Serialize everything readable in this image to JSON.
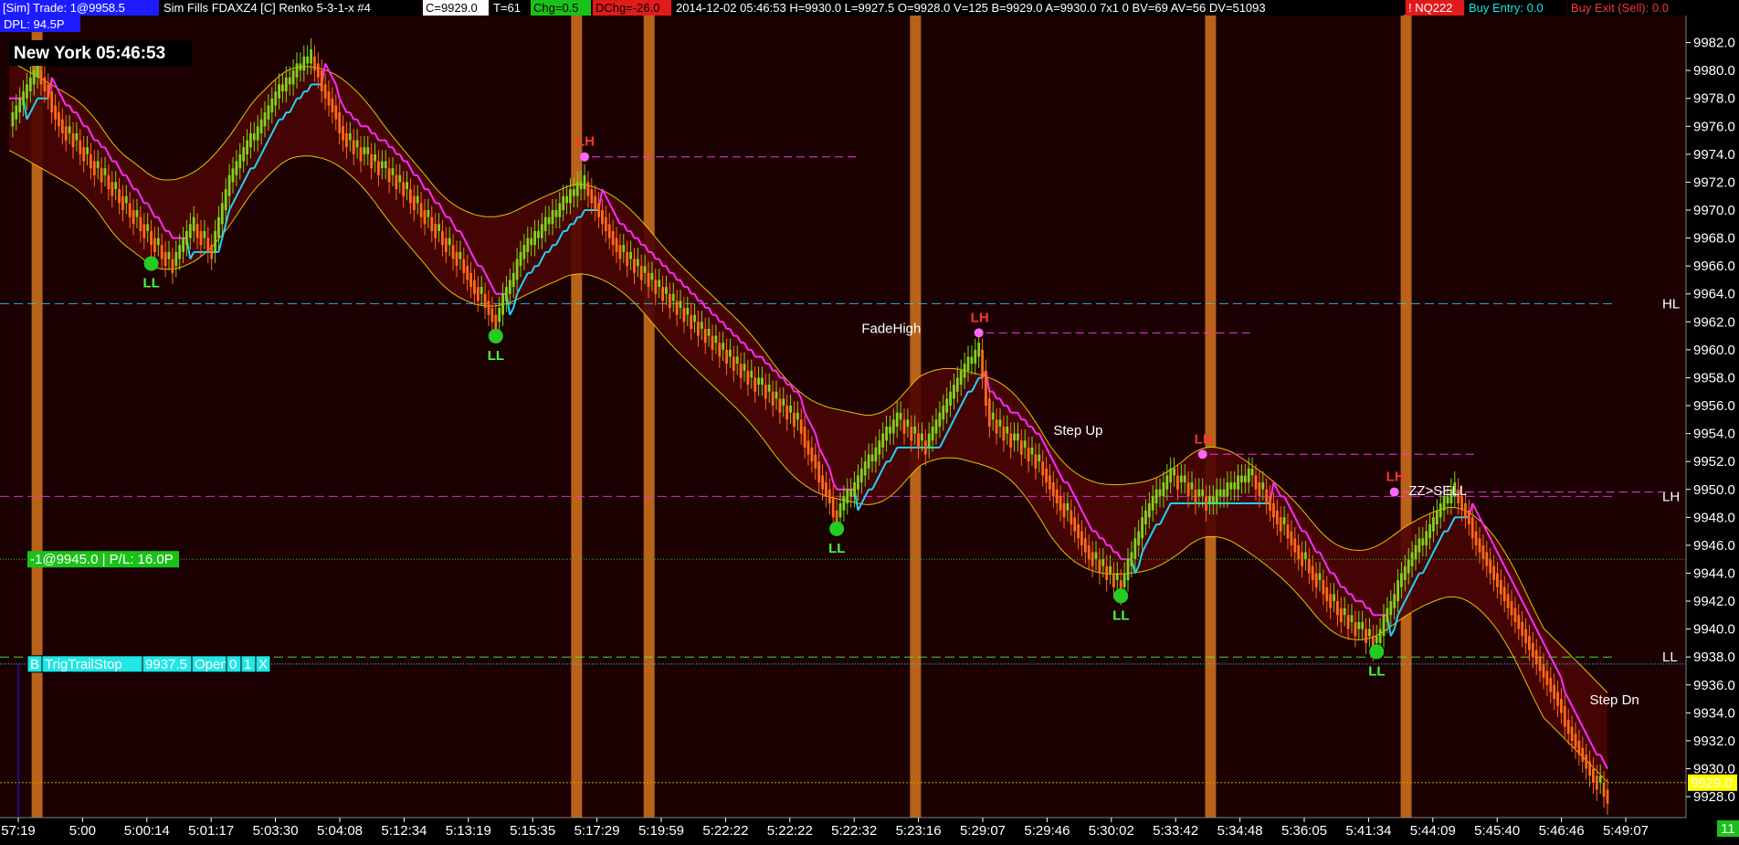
{
  "header": {
    "items": [
      {
        "text": "[Sim]  Trade: 1@9958.5",
        "bg": "#1c1cff",
        "fg": "#ffffff",
        "w": 174
      },
      {
        "text": "Sim Fills  FDAXZ4 [C]  Renko 5-3-1-x  #4",
        "bg": "#000000",
        "fg": "#ffffff",
        "w": 285
      },
      {
        "text": "C=9929.0",
        "bg": "#ffffff",
        "fg": "#000000",
        "w": 72
      },
      {
        "text": "T=61",
        "bg": "#000000",
        "fg": "#ffffff",
        "w": 42
      },
      {
        "text": "Chg=0.5",
        "bg": "#19c219",
        "fg": "#000000",
        "w": 66
      },
      {
        "text": "DChg=-26.0",
        "bg": "#e11b1b",
        "fg": "#000000",
        "w": 86
      },
      {
        "text": "2014-12-02 05:46:53 H=9930.0 L=9927.5 O=9928.0 V=125 B=9929.0 A=9930.0 7x1 0 BV=69 AV=56 DV=51093",
        "bg": "#000000",
        "fg": "#ffffff",
        "w": 800
      },
      {
        "text": "! NQ222",
        "bg": "#e11b1b",
        "fg": "#ffffff",
        "w": 64
      },
      {
        "text": "Buy Entry: 0.0",
        "bg": "#000000",
        "fg": "#1ee0e0",
        "w": 110
      },
      {
        "text": "Buy Exit (Sell): 0.0",
        "bg": "#000000",
        "fg": "#ff3333",
        "w": 140
      }
    ],
    "dpl": "DPL: 94.5P",
    "clock": "New York 05:46:53"
  },
  "chart_data": {
    "type": "renko-candlestick",
    "instrument": "FDAXZ4",
    "ylim": [
      9926.5,
      9984.0
    ],
    "y_ticks": [
      9982.0,
      9980.0,
      9978.0,
      9976.0,
      9974.0,
      9972.0,
      9970.0,
      9968.0,
      9966.0,
      9964.0,
      9962.0,
      9960.0,
      9958.0,
      9956.0,
      9954.0,
      9952.0,
      9950.0,
      9948.0,
      9946.0,
      9944.0,
      9942.0,
      9940.0,
      9938.0,
      9936.0,
      9934.0,
      9932.0,
      9930.0,
      9928.0
    ],
    "x_ticks": [
      "57:19",
      "5:00",
      "5:00:14",
      "5:01:17",
      "5:03:30",
      "5:04:08",
      "5:12:34",
      "5:13:19",
      "5:15:35",
      "5:17:29",
      "5:19:59",
      "5:22:22",
      "5:22:22",
      "5:22:32",
      "5:23:16",
      "5:29:07",
      "5:29:46",
      "5:30:02",
      "5:33:42",
      "5:34:48",
      "5:36:05",
      "5:41:34",
      "5:44:09",
      "5:45:40",
      "5:46:46",
      "5:49:07"
    ],
    "current_price": "9929.0",
    "bottom_right_badge": "11",
    "colors": {
      "up": "#7ed321",
      "down": "#ff6a1a",
      "band": "#4a0404",
      "band_edge": "#e6c200",
      "trail": "#ff2bff",
      "trail_up": "#22d3ff",
      "session": "#b8621a"
    },
    "path": [
      [
        0,
        9976.0
      ],
      [
        8,
        9980.0
      ],
      [
        15,
        9976.0
      ],
      [
        28,
        9972.0
      ],
      [
        40,
        9968.0
      ],
      [
        46,
        9966.0
      ],
      [
        52,
        9969.0
      ],
      [
        57,
        9967.0
      ],
      [
        62,
        9972.0
      ],
      [
        75,
        9978.0
      ],
      [
        85,
        9981.0
      ],
      [
        95,
        9975.0
      ],
      [
        110,
        9972.0
      ],
      [
        128,
        9966.0
      ],
      [
        137,
        9962.0
      ],
      [
        145,
        9967.0
      ],
      [
        155,
        9970.0
      ],
      [
        162,
        9972.0
      ],
      [
        172,
        9967.0
      ],
      [
        185,
        9964.0
      ],
      [
        200,
        9960.0
      ],
      [
        222,
        9955.0
      ],
      [
        233,
        9948.0
      ],
      [
        240,
        9951.0
      ],
      [
        250,
        9955.0
      ],
      [
        258,
        9953.0
      ],
      [
        268,
        9958.0
      ],
      [
        273,
        9960.0
      ],
      [
        276,
        9955.0
      ],
      [
        290,
        9952.0
      ],
      [
        305,
        9945.0
      ],
      [
        313,
        9943.0
      ],
      [
        320,
        9948.0
      ],
      [
        327,
        9951.0
      ],
      [
        338,
        9949.0
      ],
      [
        350,
        9951.0
      ],
      [
        362,
        9946.0
      ],
      [
        375,
        9941.0
      ],
      [
        385,
        9939.0
      ],
      [
        393,
        9944.0
      ],
      [
        402,
        9948.0
      ],
      [
        407,
        9950.0
      ],
      [
        416,
        9945.0
      ],
      [
        430,
        9938.0
      ],
      [
        445,
        9930.0
      ],
      [
        450,
        9928.0
      ]
    ],
    "session_bars": [
      0.022,
      0.342,
      0.385,
      0.543,
      0.718,
      0.834
    ],
    "labels": [
      {
        "text": "LL",
        "bar": 40,
        "price": 9965.0,
        "color": "#44ff44"
      },
      {
        "text": "LL",
        "bar": 137,
        "price": 9959.8,
        "color": "#44ff44"
      },
      {
        "text": "LL",
        "bar": 233,
        "price": 9946.0,
        "color": "#44ff44"
      },
      {
        "text": "LL",
        "bar": 313,
        "price": 9941.2,
        "color": "#44ff44"
      },
      {
        "text": "LL",
        "bar": 385,
        "price": 9937.2,
        "color": "#44ff44"
      },
      {
        "text": "LH",
        "bar": 162,
        "price": 9974.6,
        "color": "#ff3333"
      },
      {
        "text": "LH",
        "bar": 273,
        "price": 9962.0,
        "color": "#ff3333"
      },
      {
        "text": "LH",
        "bar": 336,
        "price": 9953.3,
        "color": "#ff3333"
      },
      {
        "text": "LH",
        "bar": 390,
        "price": 9950.6,
        "color": "#ff3333"
      }
    ],
    "annotations": [
      {
        "text": "FadeHigh",
        "color": "#ff9a3c",
        "bar": 240,
        "price": 9961.2
      },
      {
        "text": "Step Up",
        "color": "#22d3ff",
        "bar": 294,
        "price": 9953.9
      },
      {
        "text": "ZZ>SELL",
        "color": "#ff7bff",
        "bar": 394,
        "price": 9949.6
      },
      {
        "text": "Step Dn",
        "color": "#ff2bff",
        "bar": 445,
        "price": 9934.6
      }
    ],
    "right_labels": [
      {
        "text": "HL",
        "price": 9963.3,
        "color": "#22d3ff"
      },
      {
        "text": "LH",
        "price": 9949.5,
        "color": "#ff2bff"
      },
      {
        "text": "LL",
        "price": 9938.0,
        "color": "#44ff44"
      }
    ],
    "position_box": {
      "text": "-1@9945.0 | P/L: 16.0P",
      "price": 9945.0
    },
    "order_box": {
      "parts": [
        "B",
        "TrigTrailStop",
        "9937.5",
        "Open",
        "0",
        "1",
        "X"
      ],
      "price": 9937.5
    }
  }
}
